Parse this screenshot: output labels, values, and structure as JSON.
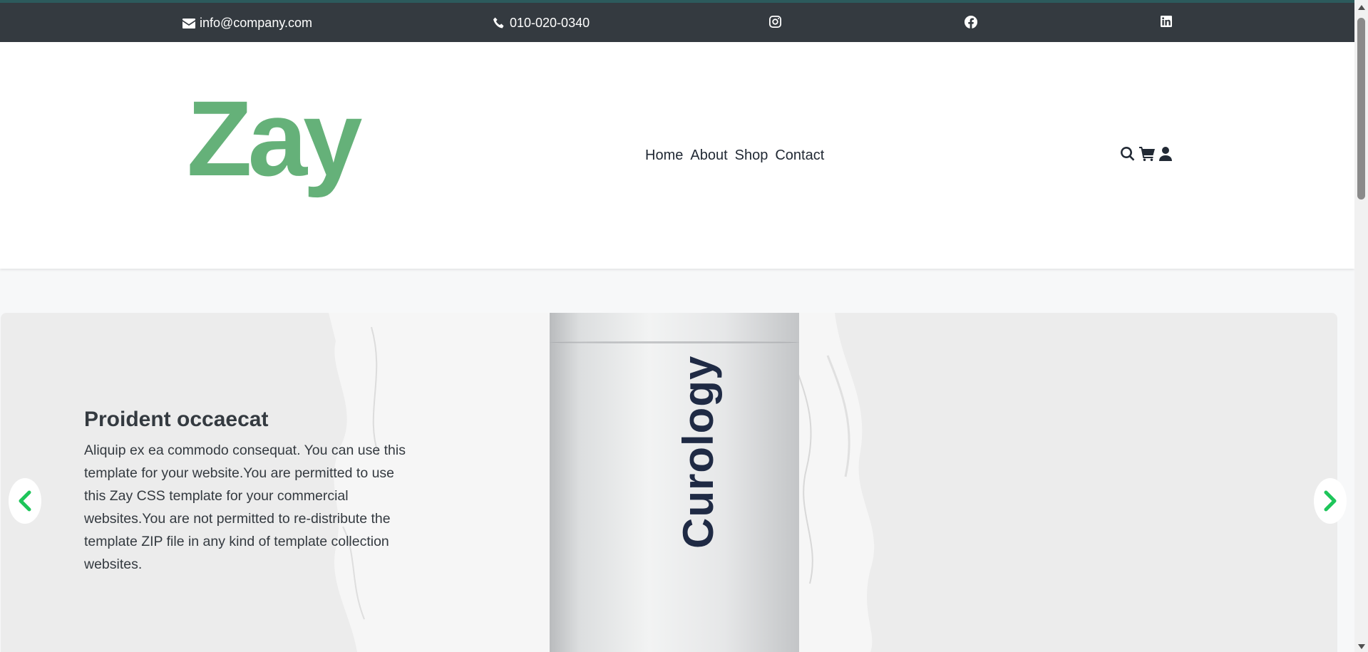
{
  "topbar": {
    "email": "info@company.com",
    "phone": "010-020-0340",
    "social": [
      "instagram-icon",
      "facebook-icon",
      "linkedin-icon"
    ]
  },
  "header": {
    "logo": "Zay",
    "logo_color": "#59ab6e",
    "nav": [
      "Home",
      "About",
      "Shop",
      "Contact"
    ],
    "tools": [
      "search-icon",
      "cart-icon",
      "user-icon"
    ]
  },
  "carousel": {
    "title": "Proident occaecat",
    "text": "Aliquip ex ea commodo consequat. You can use this template for your website.You are permitted to use this Zay CSS template for your commercial websites.You are not permitted to re-distribute the template ZIP file in any kind of template collection websites.",
    "product_label": "Curology",
    "arrow_color": "#1ec55a"
  },
  "colors": {
    "topbar_bg": "#343a40",
    "page_bg": "#f7f8f9"
  }
}
